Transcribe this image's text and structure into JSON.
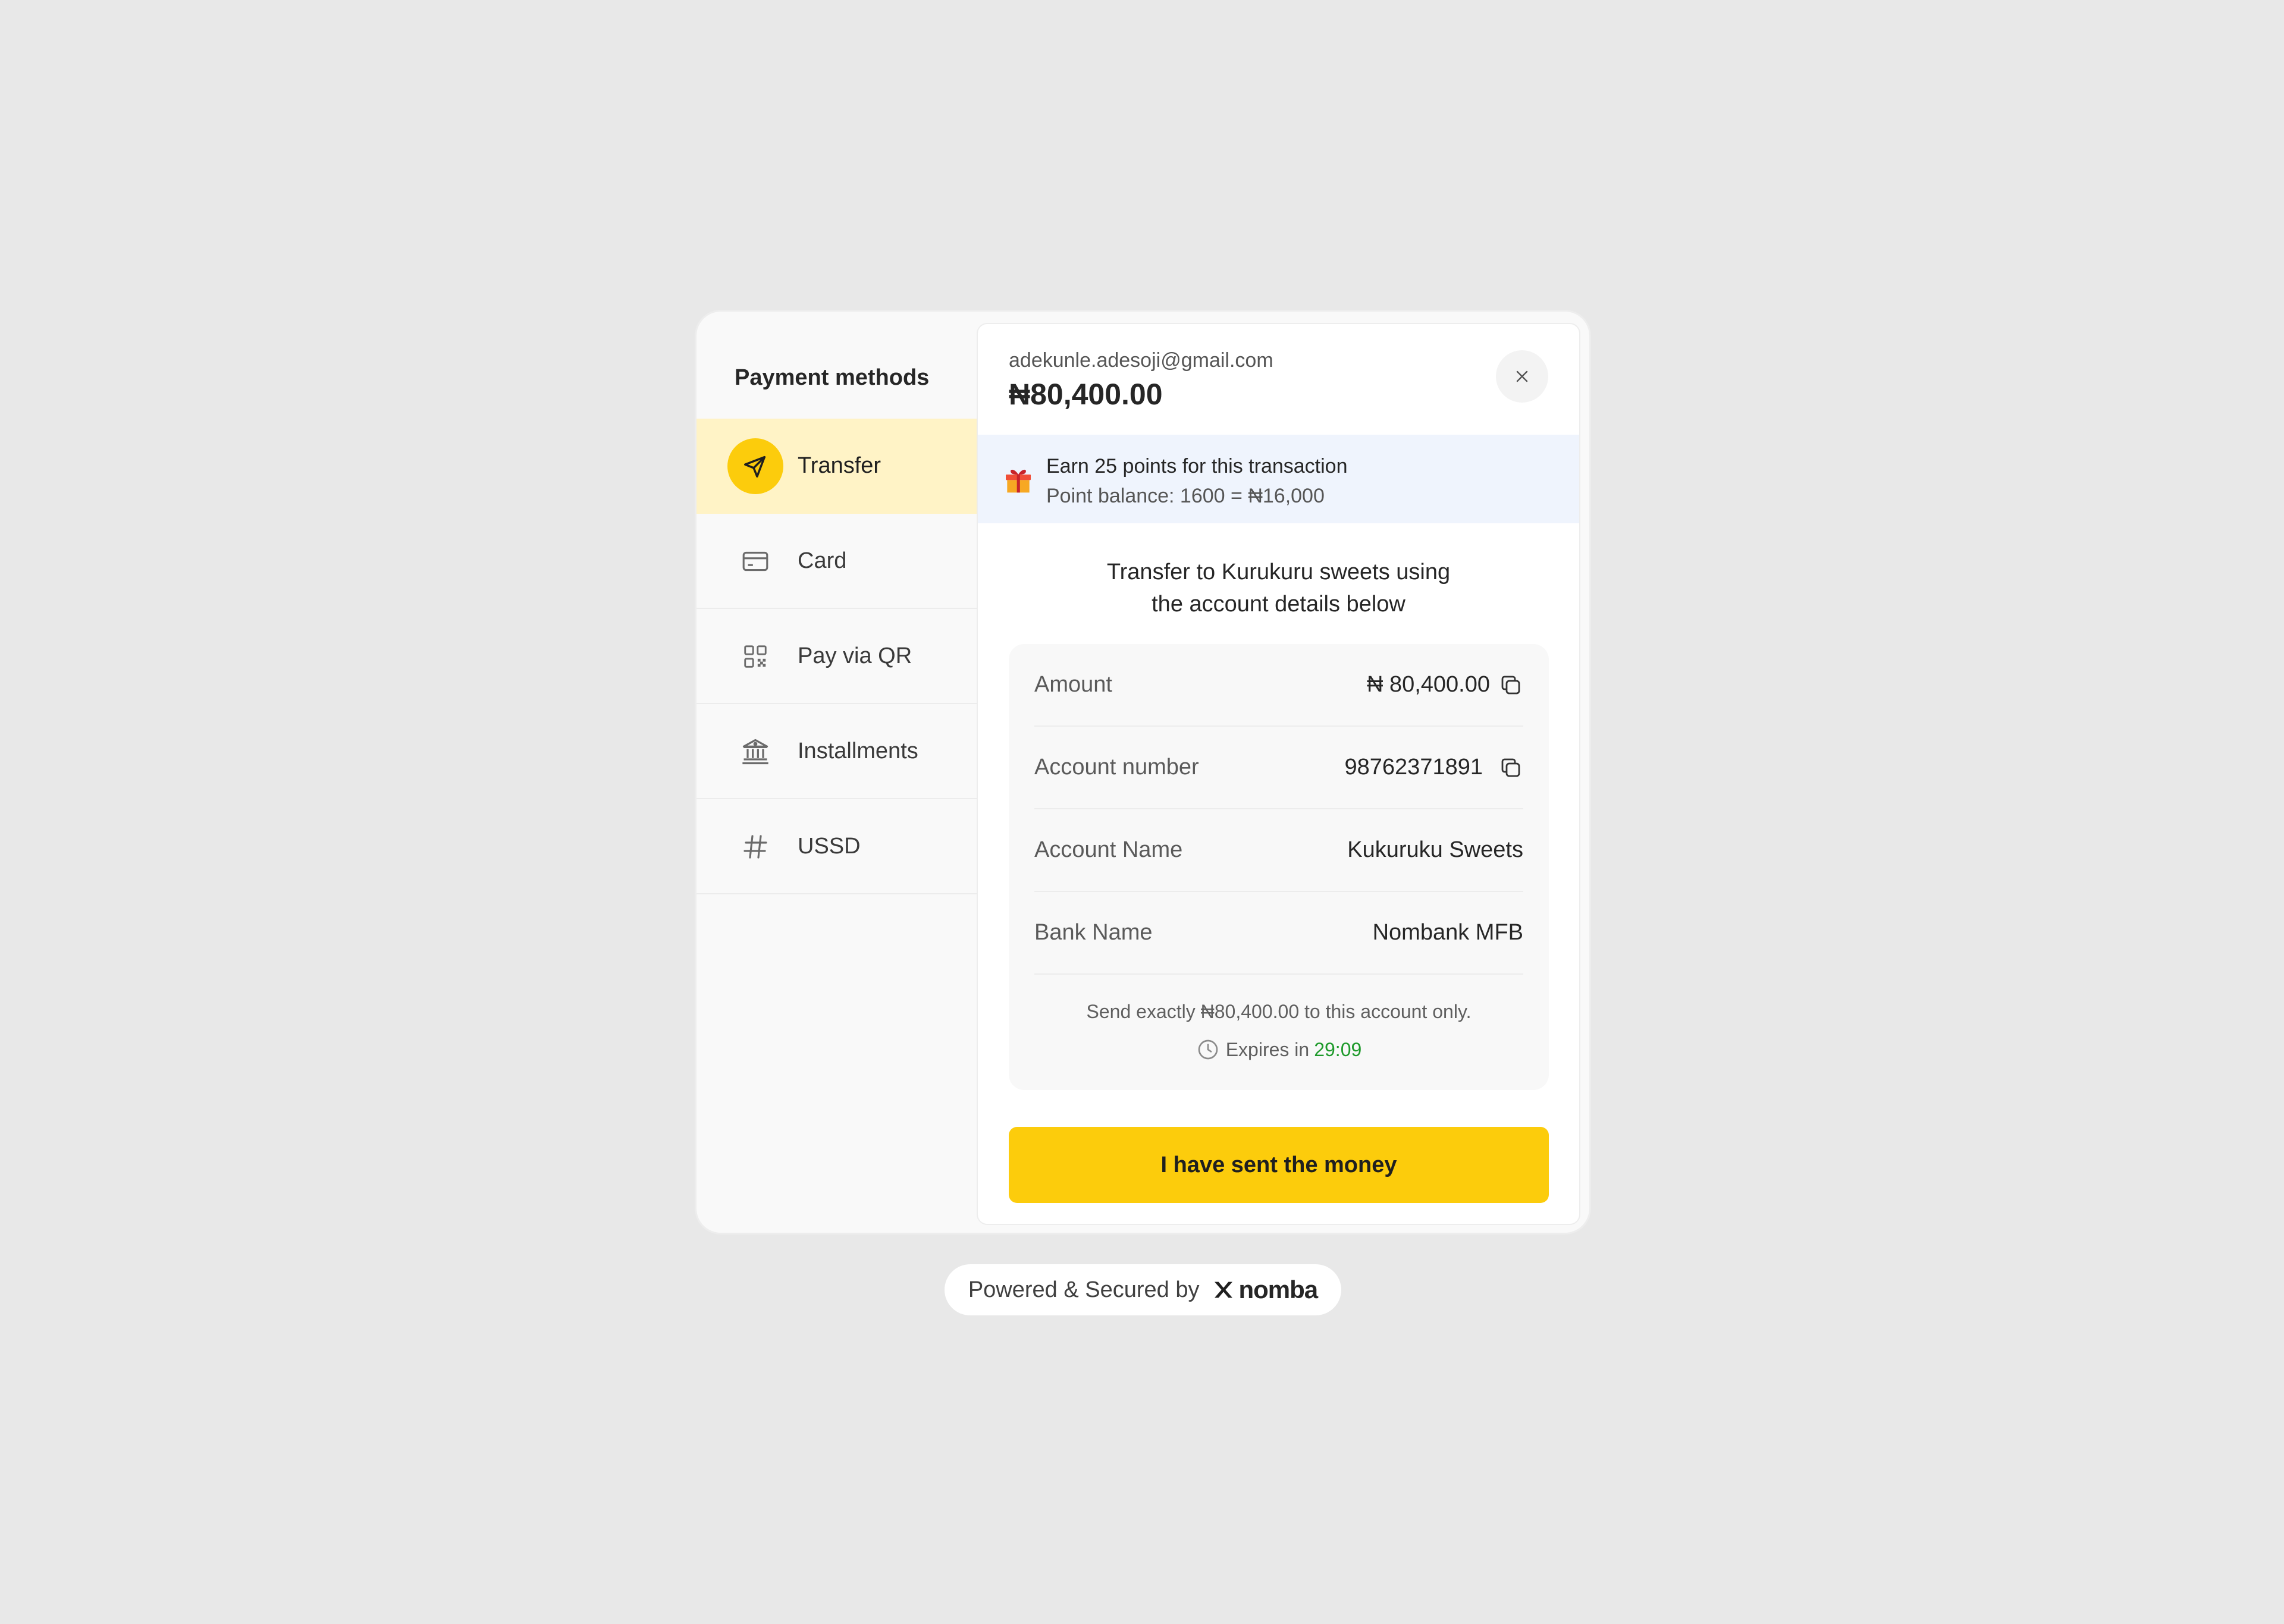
{
  "sidebar": {
    "title": "Payment methods",
    "items": [
      {
        "label": "Transfer",
        "icon": "send-icon",
        "active": true
      },
      {
        "label": "Card",
        "icon": "card-icon"
      },
      {
        "label": "Pay via QR",
        "icon": "qr-icon"
      },
      {
        "label": "Installments",
        "icon": "bank-icon"
      },
      {
        "label": "USSD",
        "icon": "hash-icon"
      }
    ]
  },
  "header": {
    "email": "adekunle.adesoji@gmail.com",
    "amount": "₦80,400.00"
  },
  "points": {
    "line1": "Earn 25 points for this transaction",
    "line2": "Point balance: 1600 = ₦16,000"
  },
  "transfer": {
    "instruction_line1": "Transfer to Kurukuru sweets using",
    "instruction_line2": "the account details below",
    "rows": [
      {
        "label": "Amount",
        "value": "₦ 80,400.00"
      },
      {
        "label": "Account number",
        "value": "98762371891"
      },
      {
        "label": "Account Name",
        "value": "Kukuruku Sweets"
      },
      {
        "label": "Bank Name",
        "value": "Nombank MFB"
      }
    ],
    "note": "Send exactly ₦80,400.00 to this account only.",
    "expires_label": "Expires in",
    "expires_time": "29:09"
  },
  "cta_label": "I have sent the money",
  "footer": {
    "powered_text": "Powered & Secured by",
    "brand": "nomba"
  },
  "colors": {
    "accent": "#fccc0c",
    "active_bg": "#fff3c6",
    "points_bg": "#eff4fd",
    "timer": "#1e9a2b"
  }
}
